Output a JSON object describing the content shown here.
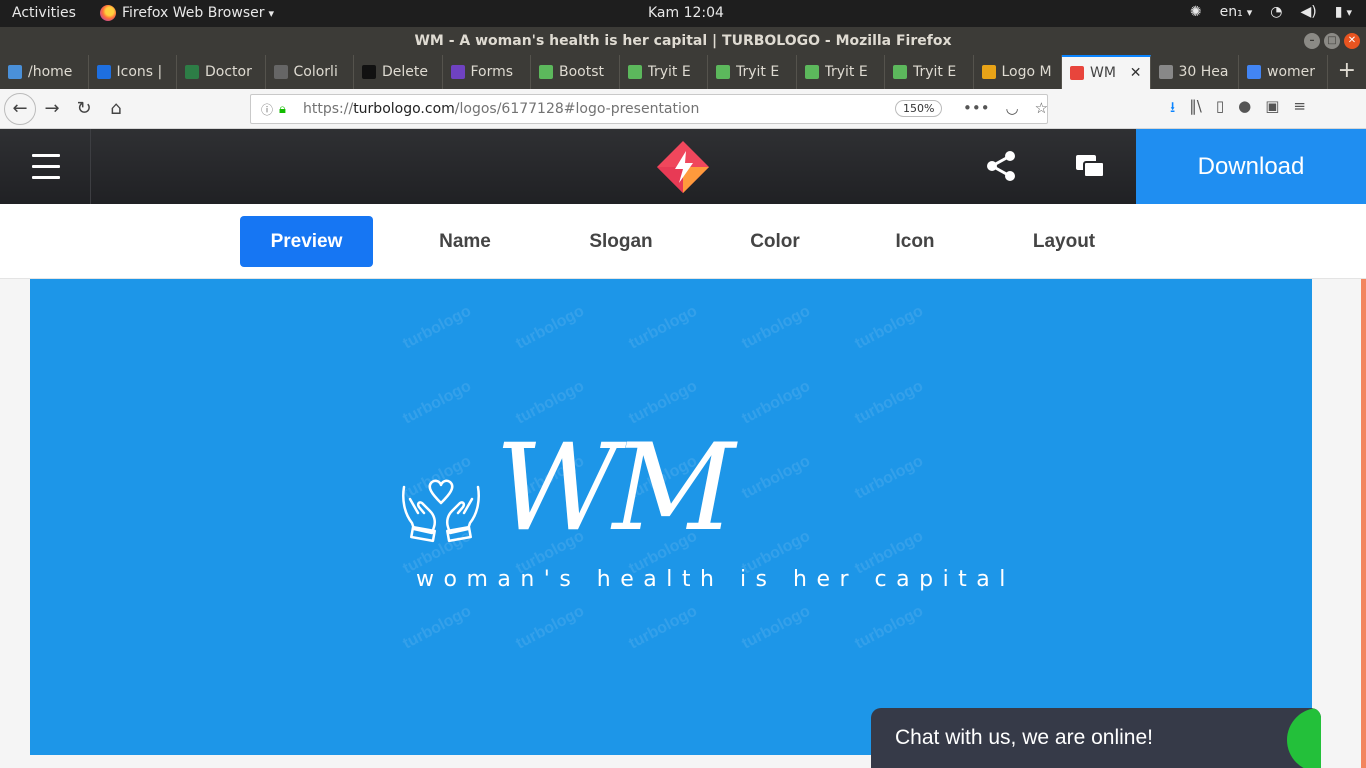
{
  "system_bar": {
    "activities": "Activities",
    "app_menu": "Firefox Web Browser",
    "clock": "Kam 12:04",
    "language": "en₁"
  },
  "window": {
    "title": "WM - A woman's health is her capital | TURBOLOGO - Mozilla Firefox"
  },
  "tabs": [
    {
      "label": "/home",
      "color": "#4a90d9"
    },
    {
      "label": "Icons |",
      "color": "#1e6fe0"
    },
    {
      "label": "Doctor",
      "color": "#2d7d46"
    },
    {
      "label": "Colorli",
      "color": "#666666"
    },
    {
      "label": "Delete",
      "color": "#111111"
    },
    {
      "label": "Forms",
      "color": "#6f42c1"
    },
    {
      "label": "Bootst",
      "color": "#5cb85c"
    },
    {
      "label": "Tryit E",
      "color": "#5cb85c"
    },
    {
      "label": "Tryit E",
      "color": "#5cb85c"
    },
    {
      "label": "Tryit E",
      "color": "#5cb85c"
    },
    {
      "label": "Tryit E",
      "color": "#5cb85c"
    },
    {
      "label": "Logo M",
      "color": "#e8a317"
    },
    {
      "label": "WM",
      "color": "#e8453c"
    },
    {
      "label": "30 Hea",
      "color": "#888888"
    },
    {
      "label": "womer",
      "color": "#4285f4"
    }
  ],
  "navbar": {
    "url_prefix": "https://",
    "url_host": "turbologo.com",
    "url_path": "/logos/6177128#logo-presentation",
    "zoom": "150%"
  },
  "site": {
    "download_label": "Download",
    "subnav": [
      "Preview",
      "Name",
      "Slogan",
      "Color",
      "Icon",
      "Layout"
    ],
    "active_tab": "Preview",
    "accent_color": "#1f8ef1"
  },
  "logo": {
    "name": "WM",
    "slogan": "woman's health is her capital",
    "background": "#1d96e8",
    "watermark": "turbologo"
  },
  "chat": {
    "label": "Chat with us, we are online!"
  }
}
